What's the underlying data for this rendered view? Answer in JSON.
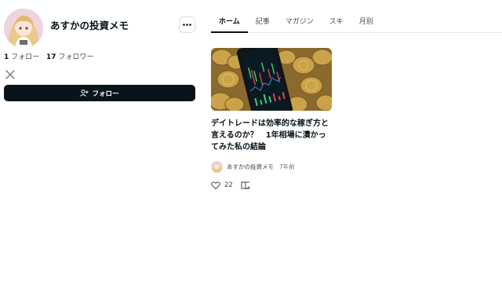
{
  "profile": {
    "name": "あすかの投資メモ",
    "follow_count": "1",
    "follow_label": "フォロー",
    "follower_count": "17",
    "follower_label": "フォロワー",
    "follow_button_label": "フォロー"
  },
  "tabs": [
    {
      "label": "ホーム",
      "active": true
    },
    {
      "label": "記事"
    },
    {
      "label": "マガジン"
    },
    {
      "label": "スキ"
    },
    {
      "label": "月別"
    }
  ],
  "article": {
    "title": "デイトレードは効率的な稼ぎ方と言えるのか？　1年相場に漬かってみた私の結論",
    "author": "あすかの投資メモ",
    "time": "7年前",
    "likes": "22"
  },
  "icons": {
    "more": "more-horizontal-icon",
    "x": "x-logo-icon",
    "follow": "user-plus-icon",
    "like": "heart-icon",
    "magazine": "magazine-add-icon"
  },
  "colors": {
    "text": "#08131a",
    "button_bg": "#08131a",
    "border": "#e5e8ea"
  }
}
